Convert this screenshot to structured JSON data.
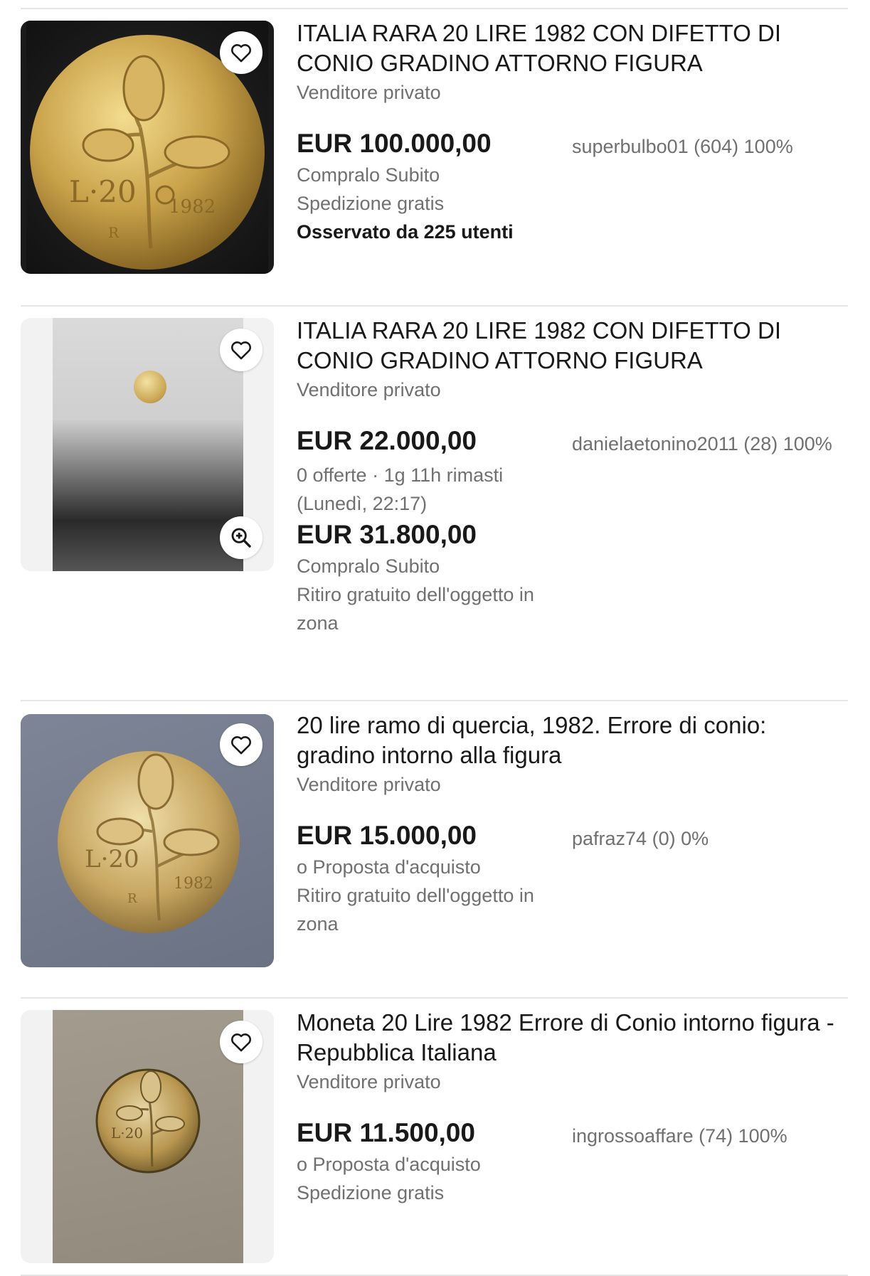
{
  "listings": [
    {
      "title": "ITALIA RARA 20 LIRE 1982 CON DIFETTO DI CONIO GRADINO ATTORNO FIGURA",
      "seller_type": "Venditore privato",
      "price": "EUR 100.000,00",
      "seller": "superbulbo01 (604) 100%",
      "line1": "Compralo Subito",
      "line2": "Spedizione gratis",
      "watchers": "Osservato da 225 utenti",
      "image_icon": "coin-photo",
      "coin_text": {
        "denomination": "L·20",
        "year": "1982",
        "mint": "R"
      }
    },
    {
      "title": "ITALIA RARA 20 LIRE 1982 CON DIFETTO DI CONIO GRADINO ATTORNO FIGURA",
      "seller_type": "Venditore privato",
      "price": "EUR 22.000,00",
      "seller": "danielaetonino2011 (28) 100%",
      "bids": "0 offerte · 1g 11h rimasti",
      "end_time": "(Lunedì, 22:17)",
      "price2": "EUR 31.800,00",
      "line1": "Compralo Subito",
      "line2": "Ritiro gratuito dell'oggetto in zona",
      "image_icon": "coin-photo"
    },
    {
      "title": "20 lire ramo di quercia, 1982. Errore di conio: gradino intorno alla figura",
      "seller_type": "Venditore privato",
      "price": "EUR 15.000,00",
      "seller": "pafraz74 (0) 0%",
      "line1": "o Proposta d'acquisto",
      "line2": "Ritiro gratuito dell'oggetto in zona",
      "image_icon": "coin-photo",
      "coin_text": {
        "denomination": "L·20",
        "year": "1982",
        "mint": "R"
      }
    },
    {
      "title": "Moneta 20 Lire 1982 Errore di Conio intorno figura - Repubblica Italiana",
      "seller_type": "Venditore privato",
      "price": "EUR 11.500,00",
      "seller": "ingrossoaffare (74) 100%",
      "line1": "o Proposta d'acquisto",
      "line2": "Spedizione gratis",
      "image_icon": "coin-photo",
      "coin_text": {
        "denomination": "L·20"
      }
    }
  ],
  "icons": {
    "watch": "heart-icon",
    "zoom": "zoom-in-icon"
  },
  "colors": {
    "text": "#191919",
    "muted": "#707070",
    "divider": "#e5e5e5"
  }
}
